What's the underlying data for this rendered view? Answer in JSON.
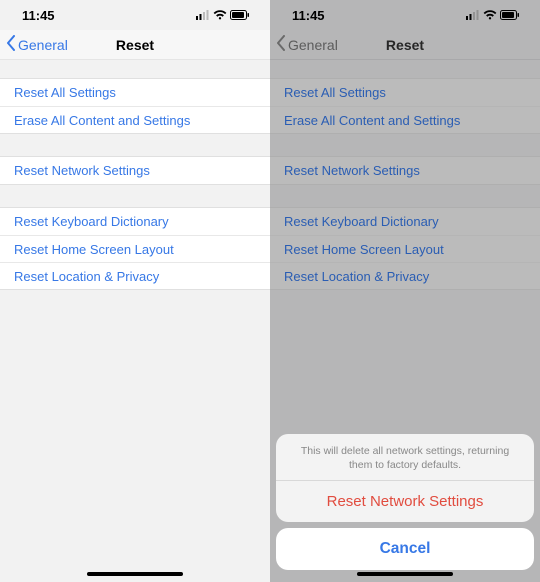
{
  "statusbar": {
    "time": "11:45"
  },
  "nav": {
    "back_label": "General",
    "title": "Reset"
  },
  "group1": {
    "item0": "Reset All Settings",
    "item1": "Erase All Content and Settings"
  },
  "group2": {
    "item0": "Reset Network Settings"
  },
  "group3": {
    "item0": "Reset Keyboard Dictionary",
    "item1": "Reset Home Screen Layout",
    "item2": "Reset Location & Privacy"
  },
  "sheet": {
    "message": "This will delete all network settings, returning them to factory defaults.",
    "action_label": "Reset Network Settings",
    "cancel_label": "Cancel"
  }
}
